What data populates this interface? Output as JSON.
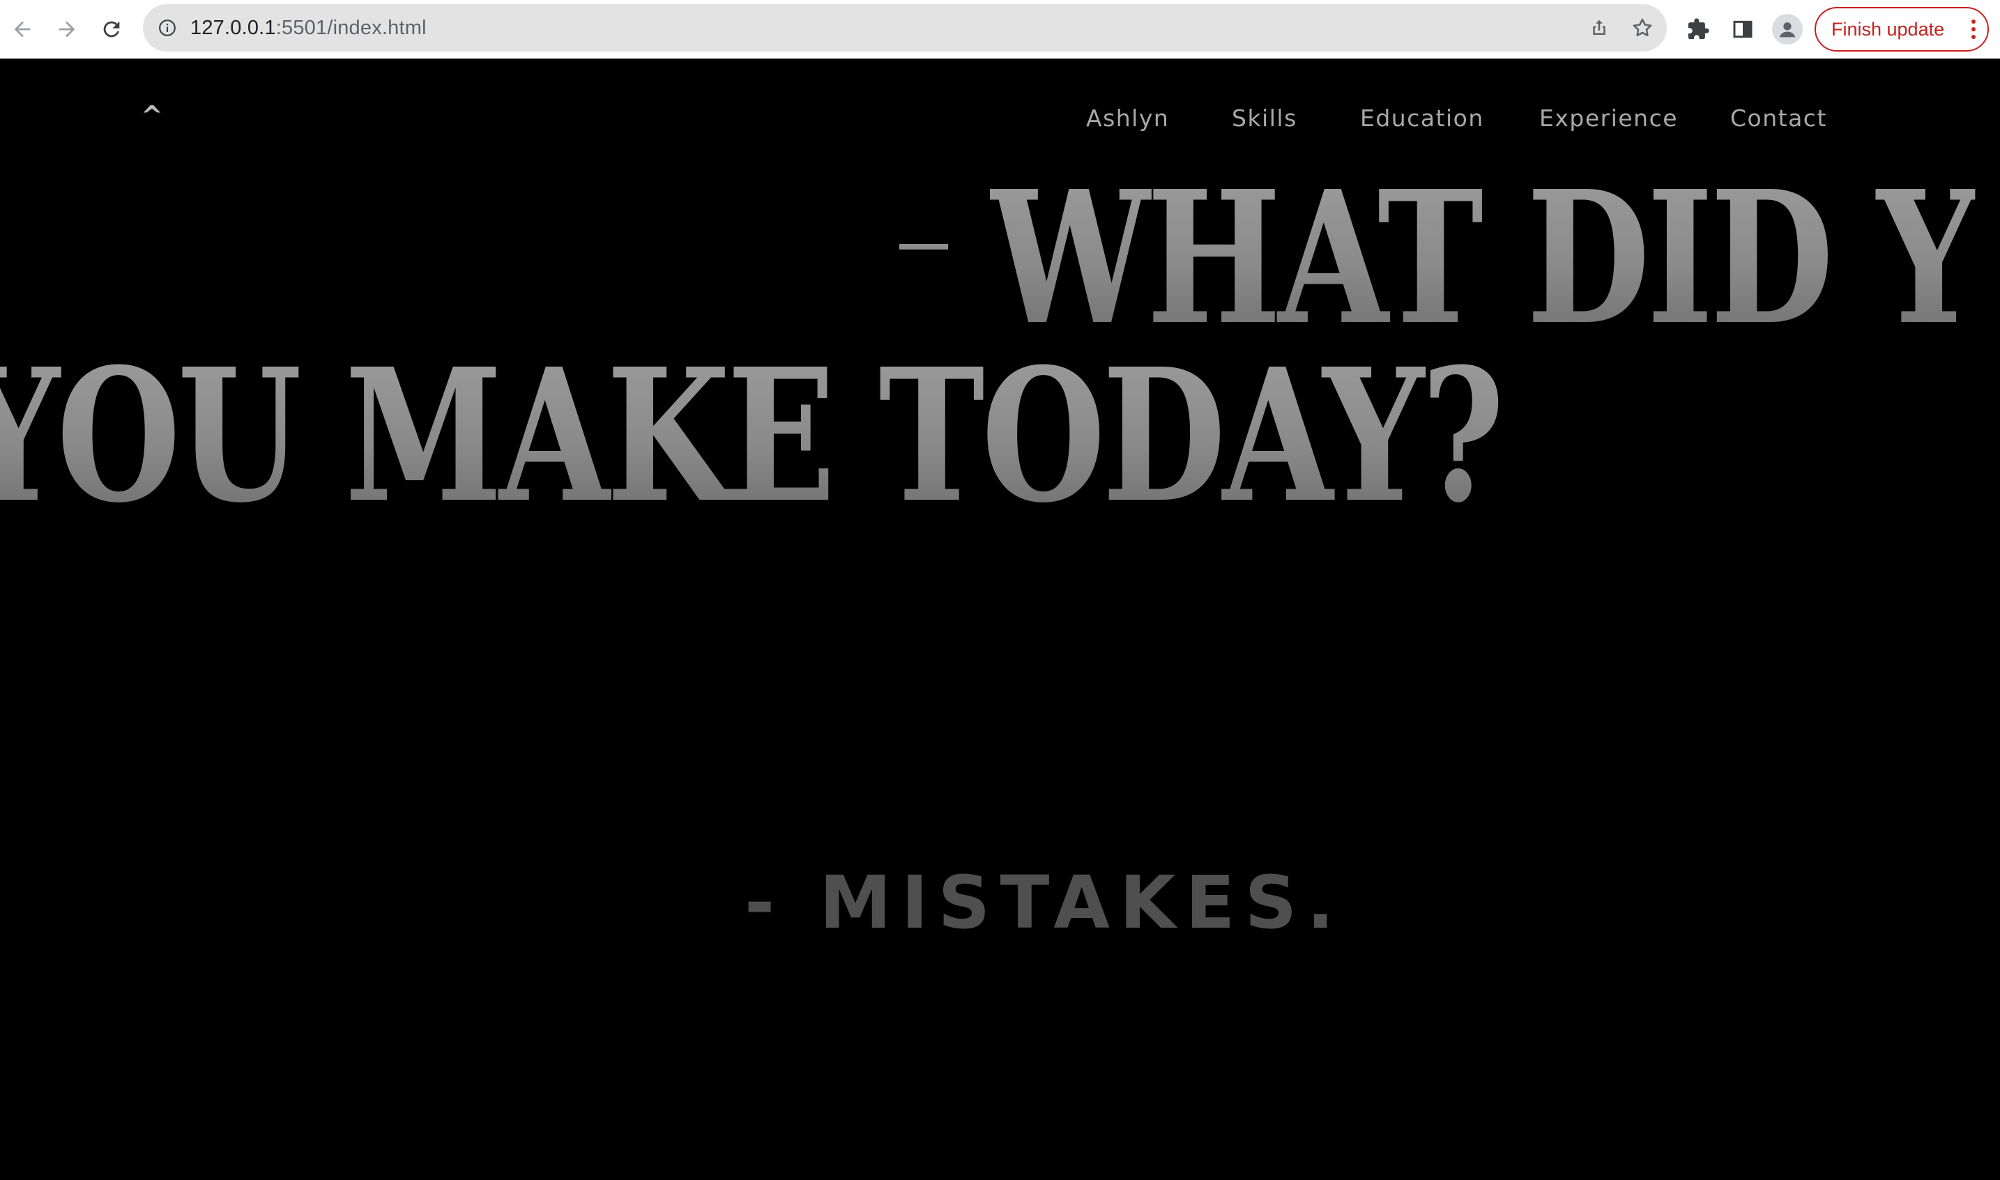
{
  "browser": {
    "url_host": "127.0.0.1",
    "url_path": ":5501/index.html",
    "update_button_label": "Finish update",
    "accent_color": "#c5221f"
  },
  "site": {
    "top_link": "^",
    "nav": {
      "ashlyn": "Ashlyn",
      "skills": "Skills",
      "education": "Education",
      "experience": "Experience",
      "contact": "Contact"
    },
    "headline_line1": "WHAT DID Y",
    "headline_line2": "YOU MAKE TODAY?",
    "answer": "- MISTAKES.",
    "background_color": "#000000",
    "text_color": "#8f8f8f"
  }
}
